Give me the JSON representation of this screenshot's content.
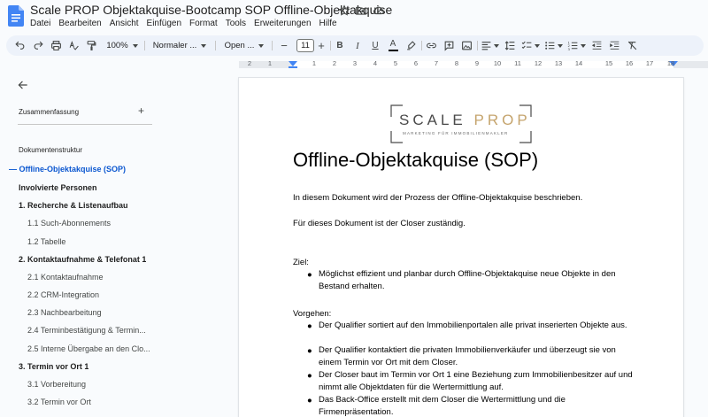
{
  "app": {
    "title": "Scale PROP Objektakquise-Bootcamp SOP Offline-Objektakquise",
    "menu": [
      "Datei",
      "Bearbeiten",
      "Ansicht",
      "Einfügen",
      "Format",
      "Tools",
      "Erweiterungen",
      "Hilfe"
    ]
  },
  "toolbar": {
    "zoom": "100%",
    "style": "Normaler ...",
    "font": "Open ...",
    "font_size": "11",
    "minus": "−",
    "plus": "+",
    "bold": "B",
    "italic": "I",
    "underline": "U",
    "text_color_letter": "A"
  },
  "ruler": {
    "numbers": [
      "2",
      "1",
      "1",
      "2",
      "3",
      "4",
      "5",
      "6",
      "7",
      "8",
      "9",
      "10",
      "11",
      "12",
      "13",
      "14",
      "15",
      "16",
      "17",
      "18"
    ]
  },
  "sidebar": {
    "summary_label": "Zusammenfassung",
    "summary_add": "+",
    "outline_label": "Dokumentenstruktur",
    "items": [
      {
        "label": "Offline-Objektakquise (SOP)",
        "level": "active"
      },
      {
        "label": "Involvierte Personen",
        "level": "h1"
      },
      {
        "label": "1. Recherche & Listenaufbau",
        "level": "h2"
      },
      {
        "label": "1.1 Such-Abonnements",
        "level": "h3"
      },
      {
        "label": "1.2 Tabelle",
        "level": "h3"
      },
      {
        "label": "2. Kontaktaufnahme & Telefonat 1",
        "level": "h2"
      },
      {
        "label": "2.1 Kontaktaufnahme",
        "level": "h3"
      },
      {
        "label": "2.2 CRM-Integration",
        "level": "h3"
      },
      {
        "label": "2.3 Nachbearbeitung",
        "level": "h3"
      },
      {
        "label": "2.4 Terminbestätigung & Termin...",
        "level": "h3"
      },
      {
        "label": "2.5 Interne Übergabe an den Clo...",
        "level": "h3"
      },
      {
        "label": "3. Termin vor Ort 1",
        "level": "h2"
      },
      {
        "label": "3.1 Vorbereitung",
        "level": "h3"
      },
      {
        "label": "3.2 Termin vor Ort",
        "level": "h3"
      }
    ]
  },
  "document": {
    "logo_scale": "SCALE",
    "logo_prop": "PROP",
    "logo_sub": "MARKETING FÜR IMMOBILIENMAKLER",
    "heading": "Offline-Objektakquise (SOP)",
    "intro": "In diesem Dokument wird der Prozess der Offline-Objektakquise beschrieben.",
    "responsible": "Für dieses Dokument ist der Closer zuständig.",
    "goal_label": "Ziel:",
    "goal_bullets": [
      "Möglichst effizient und planbar durch Offline-Objektakquise neue Objekte in den Bestand erhalten."
    ],
    "procedure_label": "Vorgehen:",
    "procedure_bullets": [
      "Der Qualifier sortiert auf den Immobilienportalen alle privat inserierten Objekte aus.",
      "Der Qualifier kontaktiert die privaten Immobilienverkäufer und überzeugt sie von einem Termin vor Ort mit dem Closer.",
      "Der Closer baut im Termin vor Ort 1 eine Beziehung zum Immobilienbesitzer auf und nimmt alle Objektdaten für die Wertermittlung auf.",
      "Das Back-Office erstellt mit dem Closer die Wertermittlung und die Firmenpräsentation."
    ]
  },
  "colors": {
    "accent_blue": "#0b57d0",
    "toolbar_bg": "#edf2fa",
    "logo_gold": "#c5a46d"
  }
}
